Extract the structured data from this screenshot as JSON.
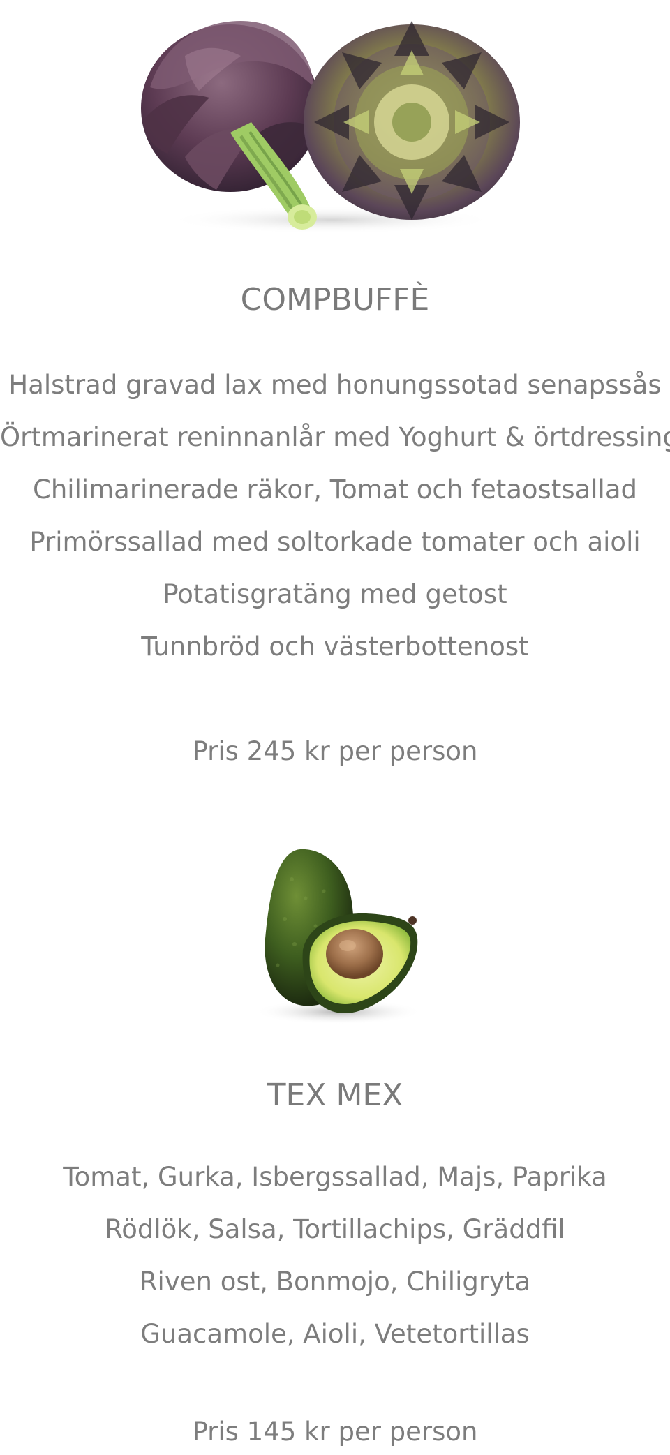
{
  "sections": [
    {
      "image": "artichoke-image",
      "title": "COMPBUFFÈ",
      "items": [
        "Halstrad gravad lax med honungssotad senapssås",
        "Örtmarinerat reninnanlår med Yoghurt & örtdressing",
        "Chilimarinerade räkor, Tomat och fetaostsallad",
        "Primörssallad med soltorkade tomater och aioli",
        "Potatisgratäng med getost",
        "Tunnbröd och västerbottenost"
      ],
      "price": "Pris 245 kr per person"
    },
    {
      "image": "avocado-image",
      "title": "TEX MEX",
      "items": [
        "Tomat, Gurka, Isbergssallad, Majs, Paprika",
        "Rödlök, Salsa, Tortillachips, Gräddfil",
        "Riven ost, Bonmojo, Chiligryta",
        "Guacamole, Aioli, Vetetortillas"
      ],
      "price": "Pris 145 kr per person"
    }
  ]
}
